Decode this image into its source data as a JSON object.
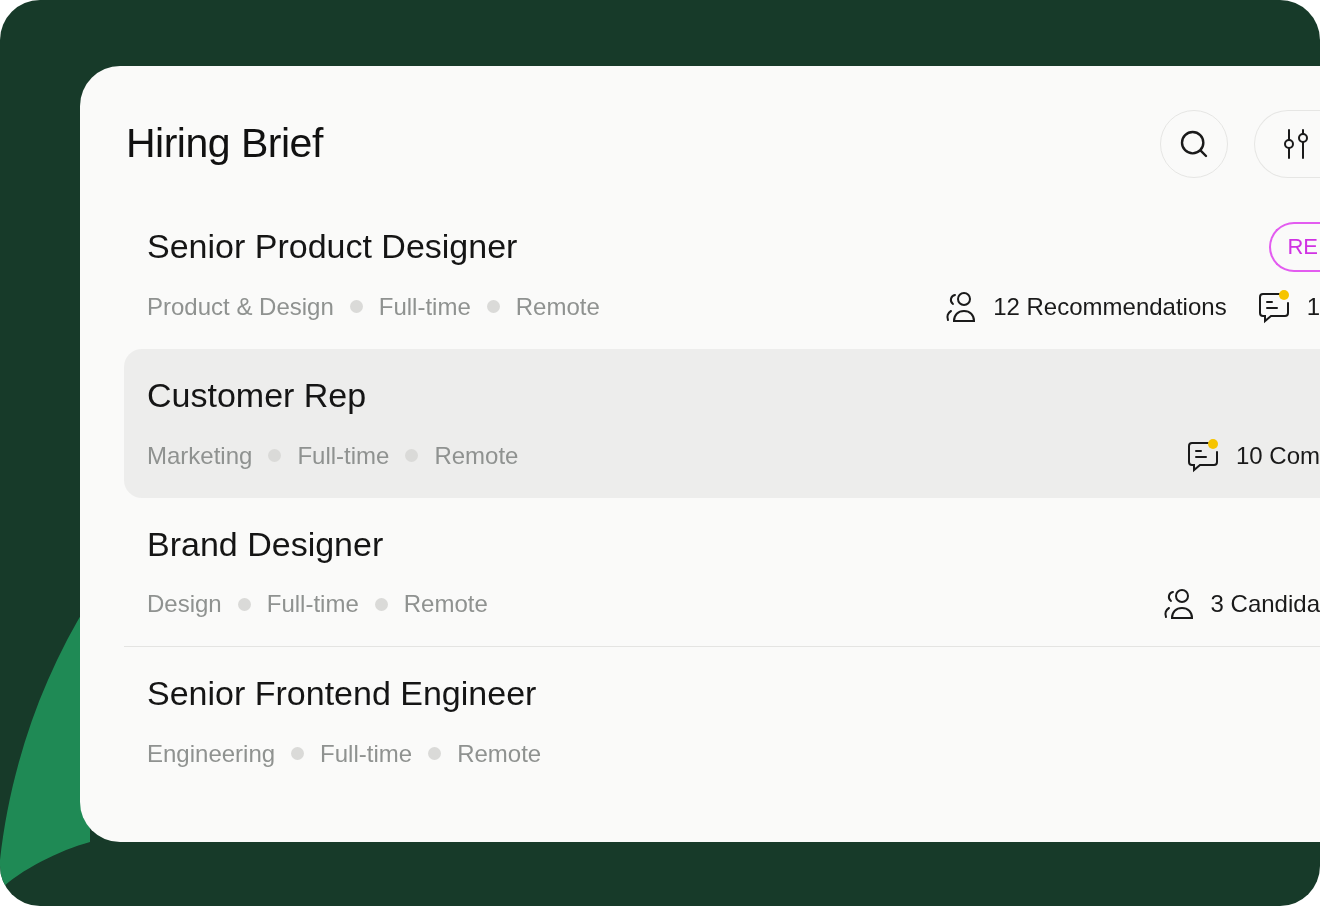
{
  "title": "Hiring Brief",
  "jobs": [
    {
      "title": "Senior Product Designer",
      "selected": false,
      "badge": "RE",
      "meta": [
        "Product & Design",
        "Full-time",
        "Remote"
      ],
      "stats": [
        {
          "kind": "candidates",
          "text": "12 Recommendations"
        },
        {
          "kind": "comments",
          "text": "1",
          "unread": true
        }
      ]
    },
    {
      "title": "Customer Rep",
      "selected": true,
      "meta": [
        "Marketing",
        "Full-time",
        "Remote"
      ],
      "stats": [
        {
          "kind": "comments",
          "text": "10 Com",
          "unread": true
        }
      ]
    },
    {
      "title": "Brand Designer",
      "selected": false,
      "meta": [
        "Design",
        "Full-time",
        "Remote"
      ],
      "stats": [
        {
          "kind": "candidates",
          "text": "3 Candida"
        }
      ]
    },
    {
      "title": "Senior Frontend Engineer",
      "selected": false,
      "meta": [
        "Engineering",
        "Full-time",
        "Remote"
      ]
    }
  ]
}
